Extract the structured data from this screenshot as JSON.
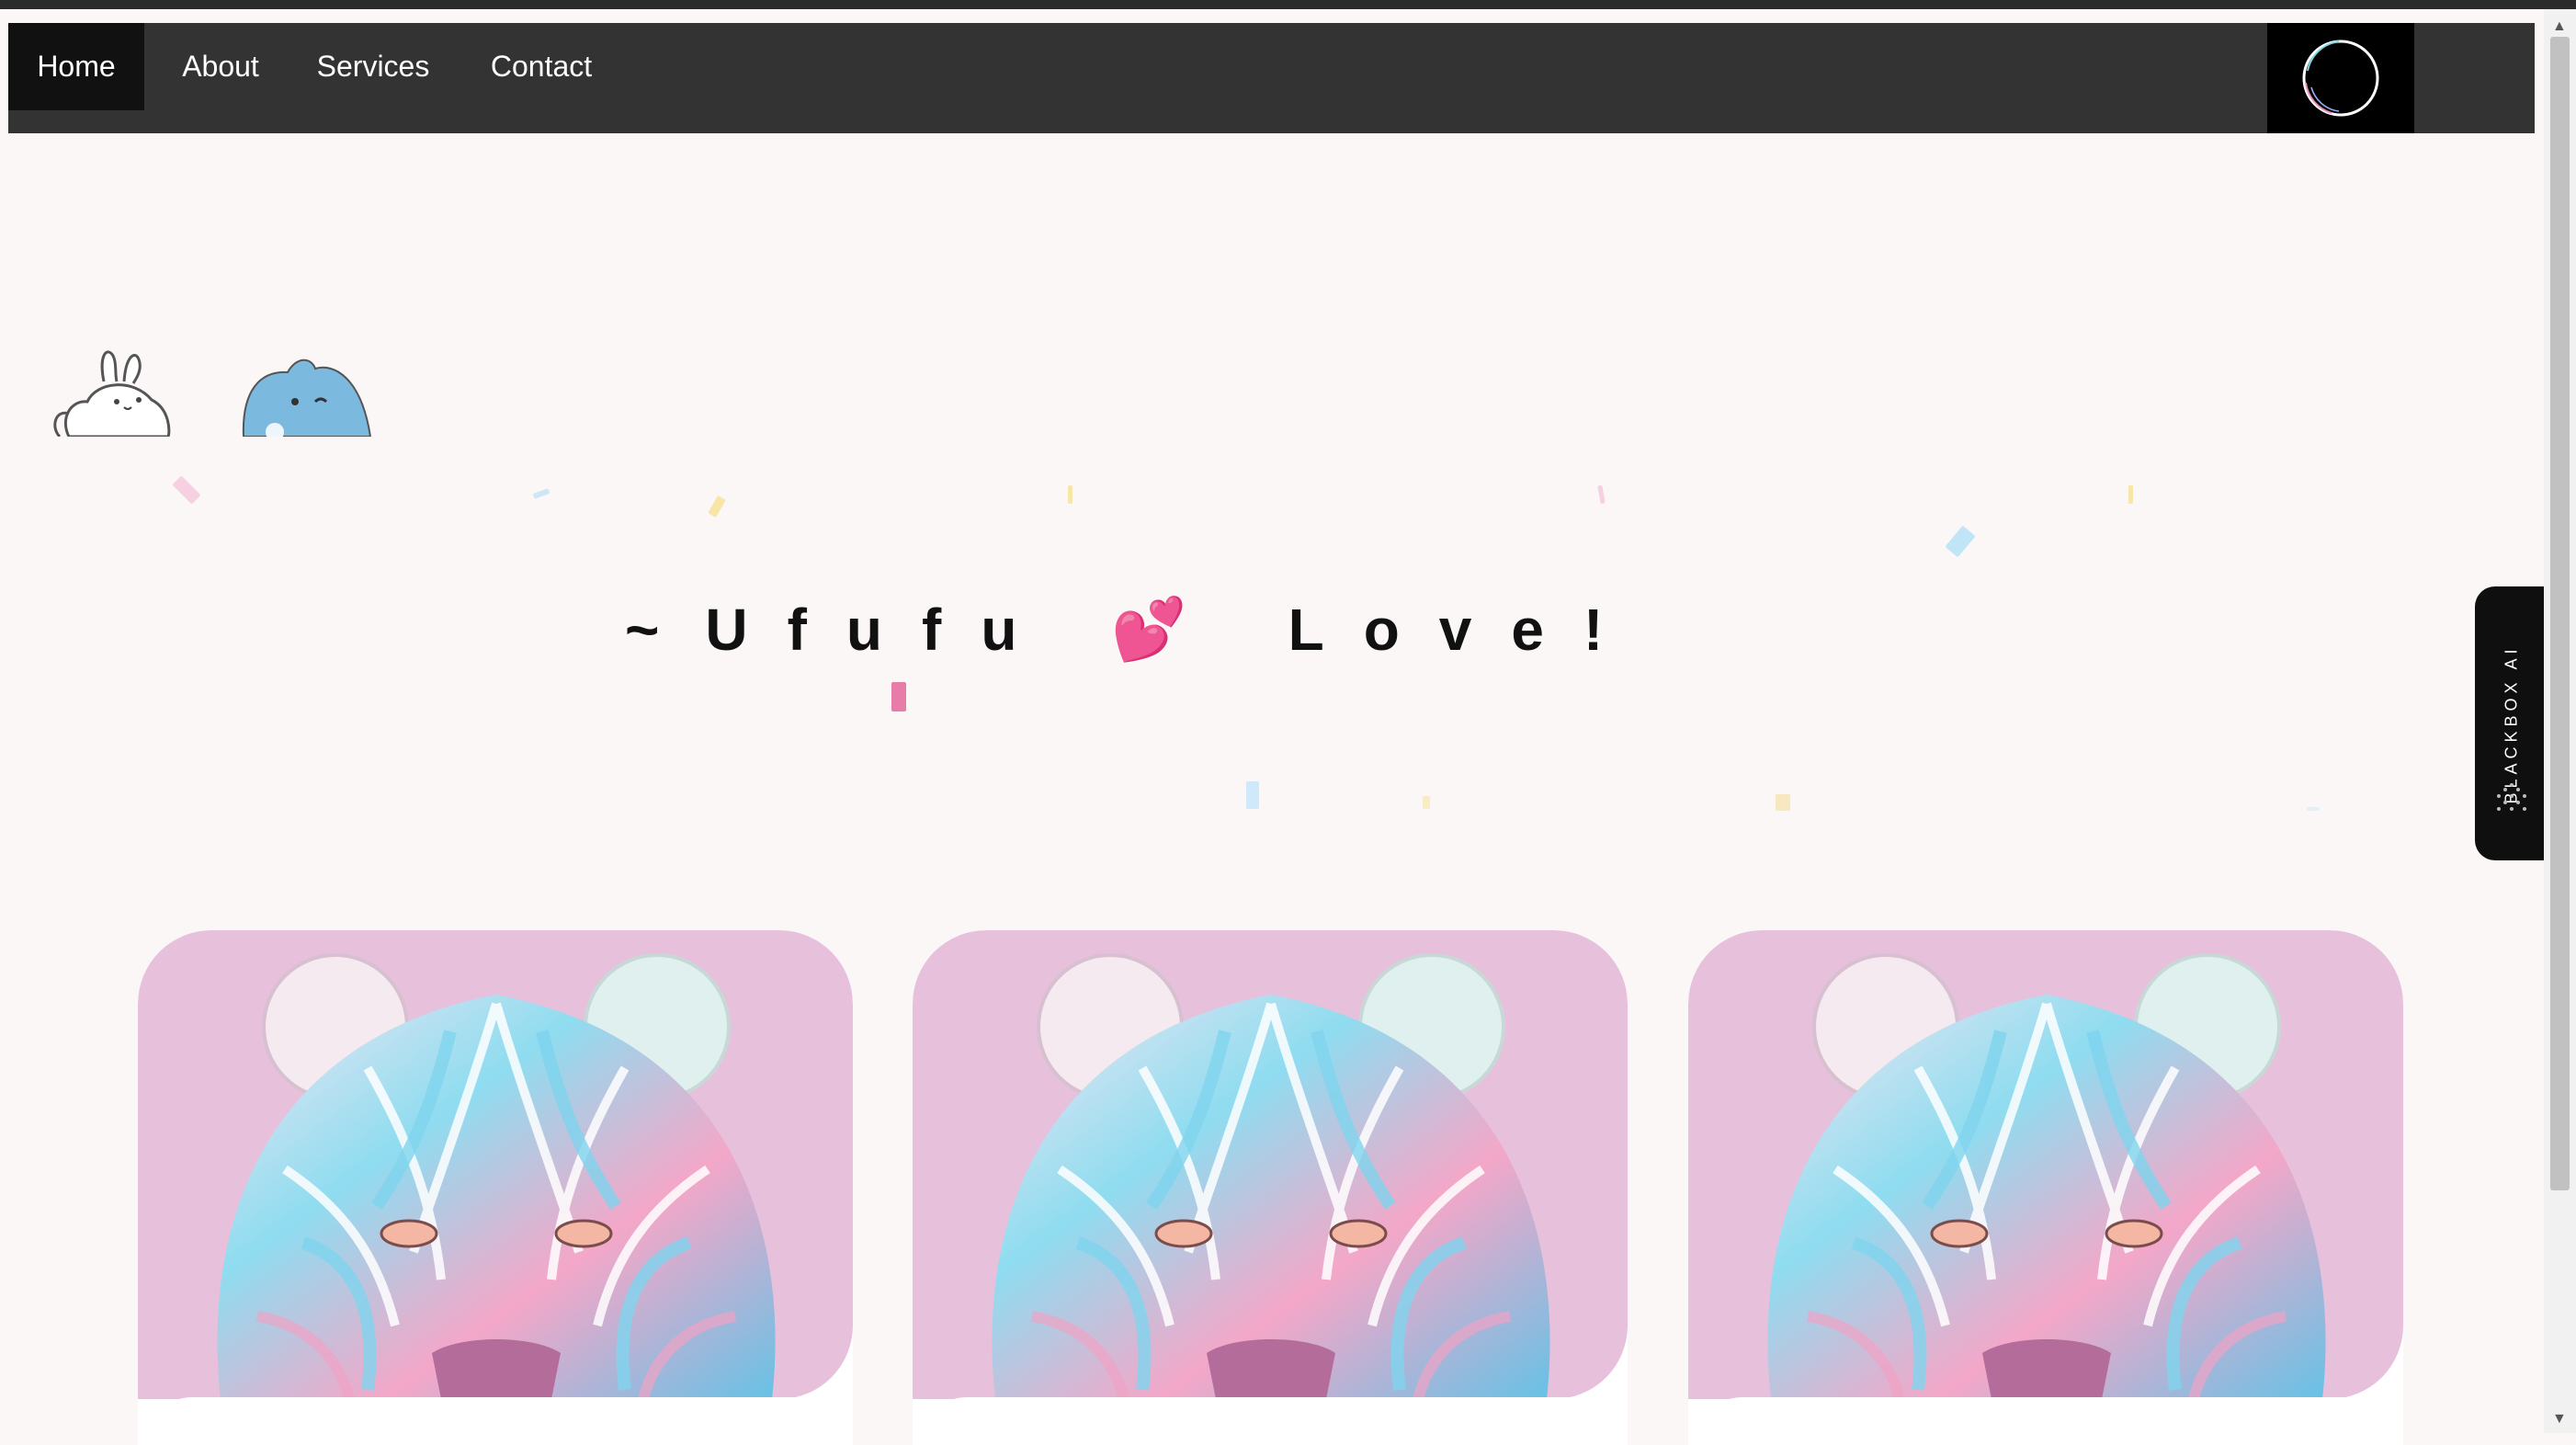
{
  "nav": {
    "items": [
      {
        "label": "Home",
        "active": true
      },
      {
        "label": "About",
        "active": false
      },
      {
        "label": "Services",
        "active": false
      },
      {
        "label": "Contact",
        "active": false
      }
    ],
    "logo_icon": "circle-logo-icon"
  },
  "hero": {
    "title_prefix": "~",
    "title_word1": "Ufufu",
    "title_emoji": "💕",
    "title_word2": "Love!"
  },
  "sidetab": {
    "label": "BLACKBOX AI",
    "icon": "dots-grid-icon"
  },
  "cards": [
    {
      "image": "pastel-bear-illustration"
    },
    {
      "image": "pastel-bear-illustration"
    },
    {
      "image": "pastel-bear-illustration"
    }
  ],
  "colors": {
    "nav_bg": "#333333",
    "nav_active": "#111111",
    "page_bg": "#faf7f6",
    "card_bg": "#e7c0dc"
  }
}
